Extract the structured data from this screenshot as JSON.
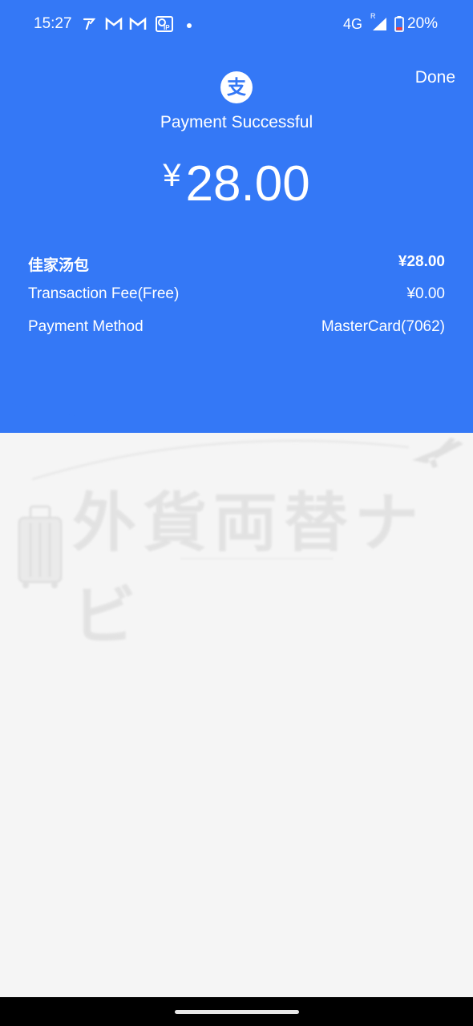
{
  "status_bar": {
    "time": "15:27",
    "network": "4G",
    "roaming": "R",
    "battery": "20%"
  },
  "header": {
    "done_label": "Done",
    "logo_glyph": "支",
    "status_title": "Payment Successful",
    "currency": "¥",
    "amount": "28.00"
  },
  "details": {
    "merchant_name": "佳家汤包",
    "merchant_amount": "¥28.00",
    "fee_label": "Transaction Fee(Free)",
    "fee_value": "¥0.00",
    "method_label": "Payment Method",
    "method_value": "MasterCard(7062)"
  },
  "watermark": {
    "text": "外貨両替ナビ"
  },
  "colors": {
    "primary": "#3478f6",
    "background": "#f5f5f5"
  }
}
